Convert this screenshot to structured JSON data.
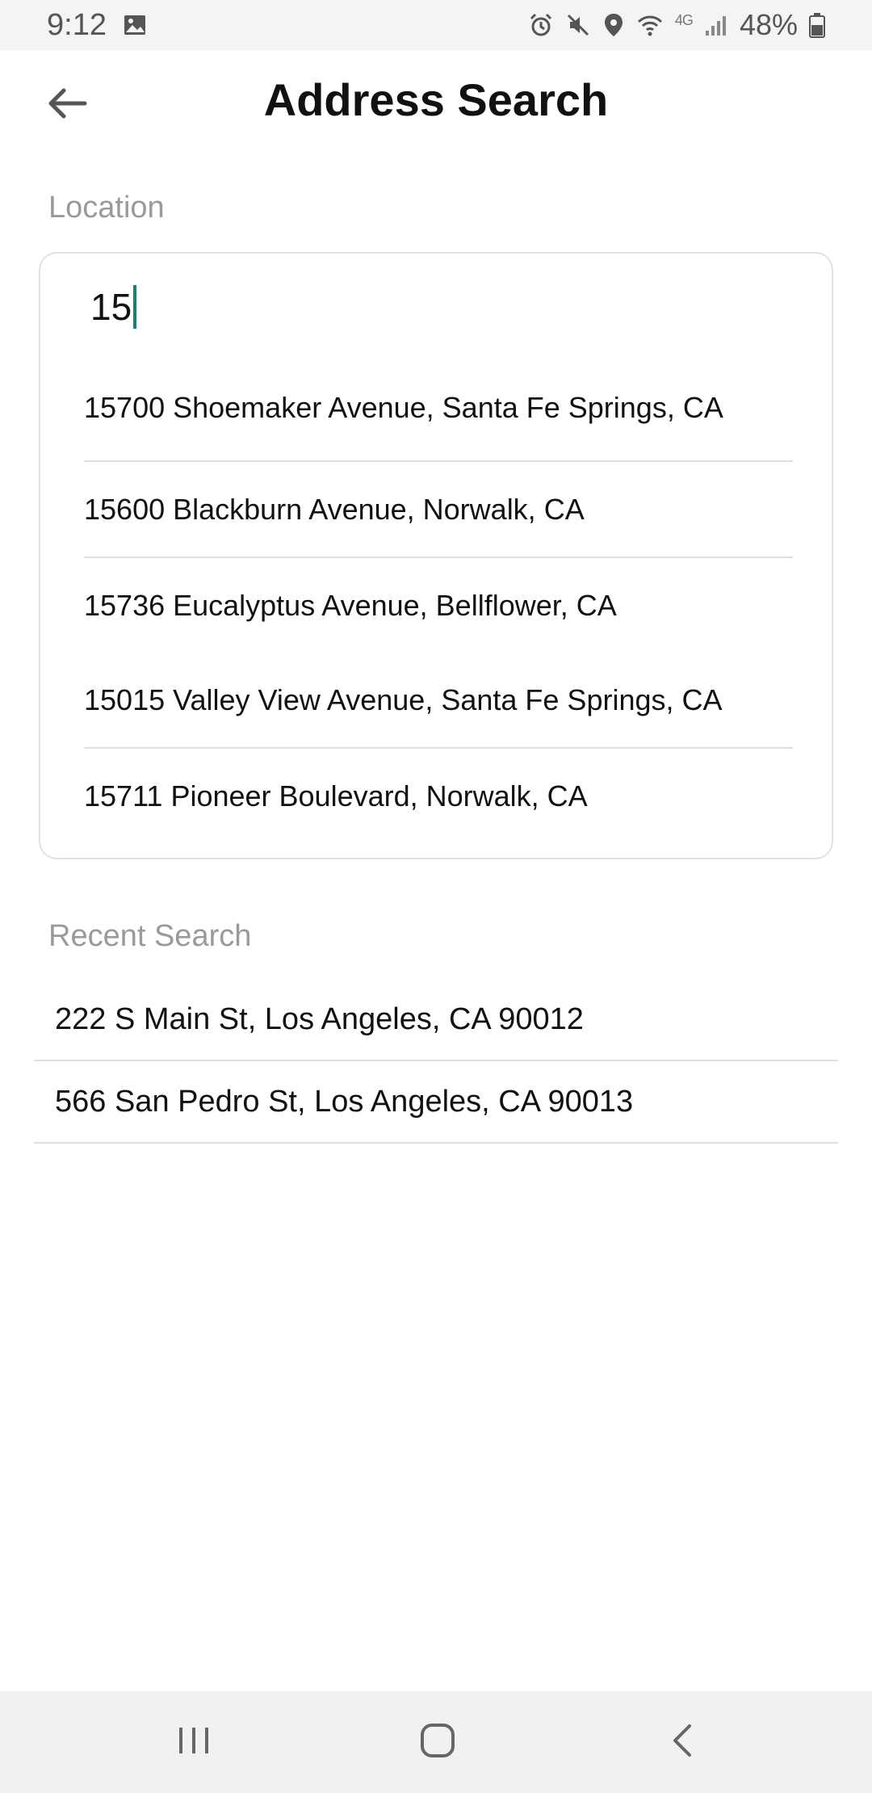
{
  "status_bar": {
    "time": "9:12",
    "network": "4G",
    "battery": "48%",
    "icons": [
      "gallery-icon",
      "alarm-icon",
      "mute-icon",
      "location-icon",
      "wifi-icon",
      "signal-icon",
      "battery-icon"
    ]
  },
  "header": {
    "title": "Address Search",
    "back_icon": "arrow-left-icon"
  },
  "location": {
    "label": "Location",
    "input_value": "15",
    "accent_color": "#1a7f74",
    "suggestions": [
      "15700 Shoemaker Avenue, Santa Fe Springs, CA",
      "15600 Blackburn Avenue, Norwalk, CA",
      "15736 Eucalyptus Avenue, Bellflower, CA",
      "15015 Valley View Avenue, Santa Fe Springs, CA",
      "15711 Pioneer Boulevard, Norwalk, CA"
    ]
  },
  "recent": {
    "label": "Recent Search",
    "items": [
      "222 S Main St, Los Angeles, CA 90012",
      "566 San Pedro St, Los Angeles, CA 90013"
    ]
  },
  "nav_bar": {
    "icons": [
      "recent-apps-icon",
      "home-icon",
      "back-icon"
    ]
  }
}
